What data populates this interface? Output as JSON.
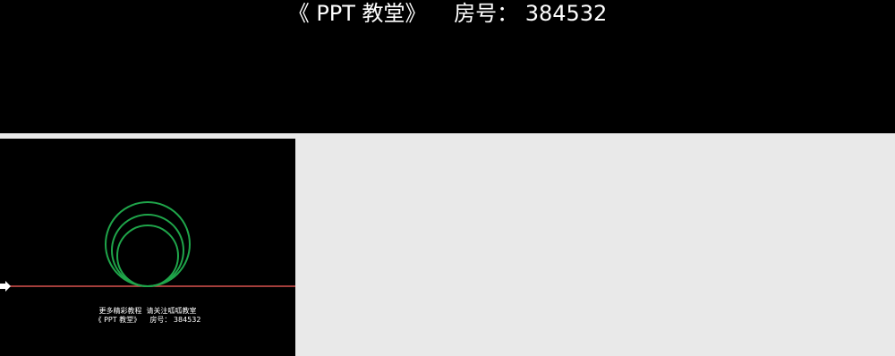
{
  "banner": {
    "title": "《 PPT 教堂》    房号： 384532"
  },
  "slide": {
    "caption_line_1": "更多精彩教程  请关注呱呱教室",
    "caption_line_2": "《 PPT 教堂》    房号： 384532",
    "colors": {
      "background": "#000000",
      "circle_stroke": "#1fa54a",
      "baseline": "#d9534f",
      "arrow": "#ffffff"
    },
    "icons": [
      "arrow-right-icon"
    ]
  },
  "workspace": {
    "background": "#e9e9e9"
  }
}
